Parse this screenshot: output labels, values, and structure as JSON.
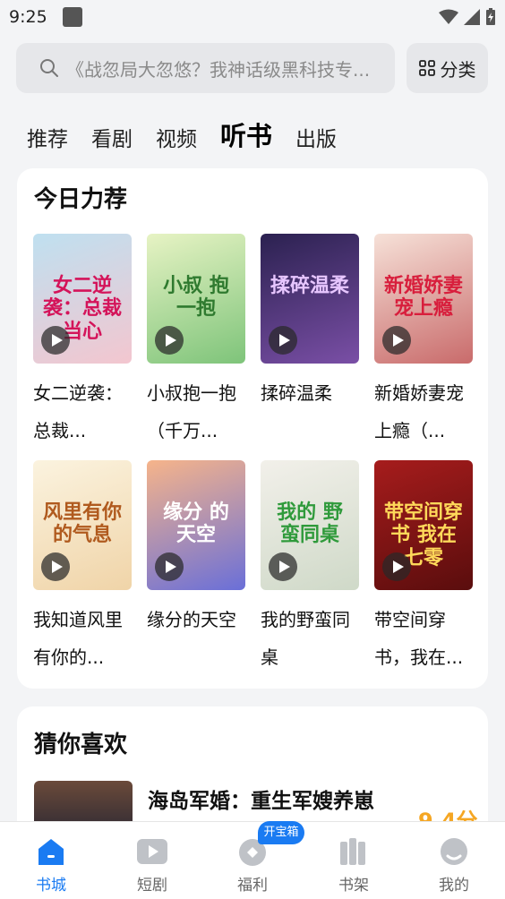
{
  "status": {
    "time": "9:25"
  },
  "search": {
    "placeholder": "《战忽局大忽悠？我神话级黑科技专..."
  },
  "category_button": {
    "label": "分类"
  },
  "tabs": [
    {
      "label": "推荐",
      "active": false
    },
    {
      "label": "看剧",
      "active": false
    },
    {
      "label": "视频",
      "active": false
    },
    {
      "label": "听书",
      "active": true
    },
    {
      "label": "出版",
      "active": false
    }
  ],
  "today": {
    "title": "今日力荐",
    "books": [
      {
        "title": "女二逆袭：总裁...",
        "cover_text": "女二逆袭：总裁 当心",
        "cover_colors": [
          "#bfe0f0",
          "#f3c6cf"
        ],
        "text_color": "#d4145a"
      },
      {
        "title": "小叔抱一抱（千万...",
        "cover_text": "小叔 抱一抱",
        "cover_colors": [
          "#e7f3c4",
          "#7ec47a"
        ],
        "text_color": "#2f7a2f"
      },
      {
        "title": "揉碎温柔",
        "cover_text": "揉碎温柔",
        "cover_colors": [
          "#2b2150",
          "#7a4fa6"
        ],
        "text_color": "#e7c6ff"
      },
      {
        "title": "新婚娇妻宠上瘾（...",
        "cover_text": "新婚娇妻 宠上瘾",
        "cover_colors": [
          "#f6e1d8",
          "#c96b6b"
        ],
        "text_color": "#d81e3c"
      },
      {
        "title": "我知道风里有你的...",
        "cover_text": "风里有你 的气息",
        "cover_colors": [
          "#fbf3df",
          "#f0d4a8"
        ],
        "text_color": "#b05a1e"
      },
      {
        "title": "缘分的天空",
        "cover_text": "缘分 的天空",
        "cover_colors": [
          "#f6b48a",
          "#6a6fd8"
        ],
        "text_color": "#ffffff"
      },
      {
        "title": "我的野蛮同桌",
        "cover_text": "我的 野蛮同桌",
        "cover_colors": [
          "#f2f0ea",
          "#cfd9c8"
        ],
        "text_color": "#2f9a3b"
      },
      {
        "title": "带空间穿书，我在...",
        "cover_text": "带空间穿书 我在七零",
        "cover_colors": [
          "#a61c1c",
          "#5a0d0d"
        ],
        "text_color": "#ffd95a"
      }
    ]
  },
  "guess": {
    "title": "猜你喜欢",
    "first_item": {
      "title": "海岛军婚：重生军嫂养崽",
      "score": "9.4分"
    }
  },
  "nav": [
    {
      "label": "书城",
      "active": true,
      "icon": "home-icon"
    },
    {
      "label": "短剧",
      "active": false,
      "icon": "play-video-icon"
    },
    {
      "label": "福利",
      "active": false,
      "icon": "gift-icon"
    },
    {
      "label": "书架",
      "active": false,
      "icon": "bookshelf-icon"
    },
    {
      "label": "我的",
      "active": false,
      "icon": "profile-icon"
    }
  ],
  "welfare_badge": "开宝箱",
  "colors": {
    "accent": "#1a7bf2",
    "score": "#f5a623",
    "background": "#f3f4f6"
  }
}
